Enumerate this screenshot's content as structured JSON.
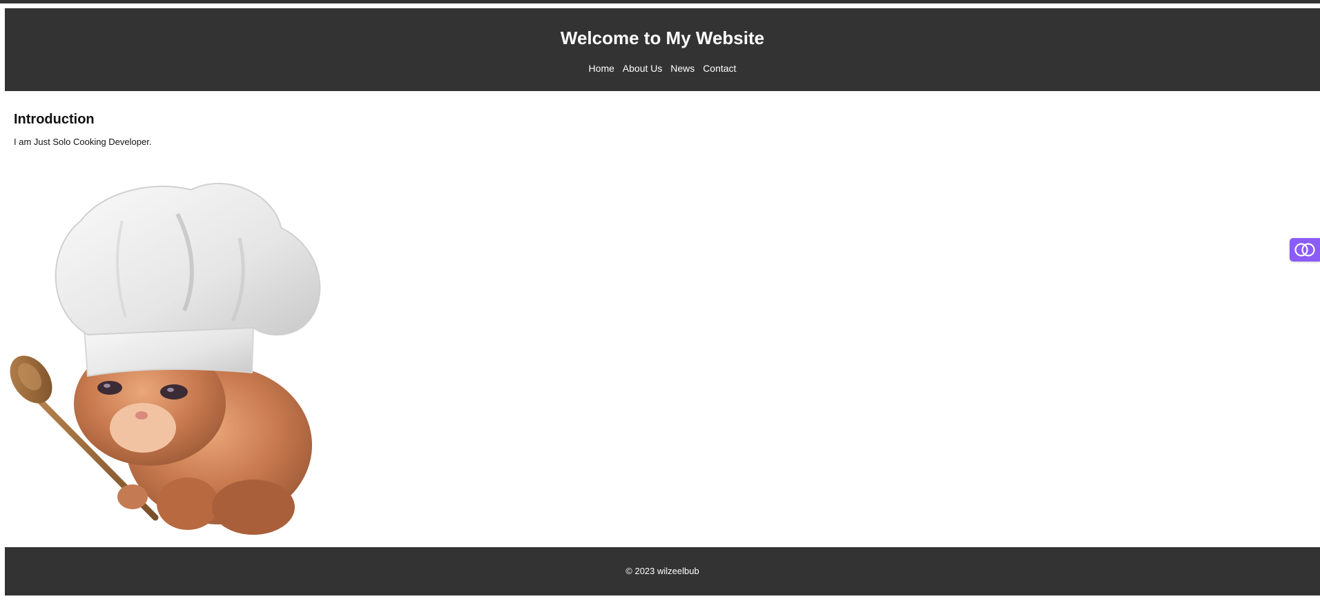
{
  "header": {
    "title": "Welcome to My Website",
    "nav": [
      {
        "label": "Home"
      },
      {
        "label": "About Us"
      },
      {
        "label": "News"
      },
      {
        "label": "Contact"
      }
    ]
  },
  "main": {
    "section_title": "Introduction",
    "intro_text": "I am Just Solo Cooking Developer.",
    "image_icon": "chef-kitten-illustration"
  },
  "footer": {
    "text": "© 2023 wilzeelbub"
  },
  "widget": {
    "icon": "overlapping-circles-icon",
    "color": "#8b5cf6"
  },
  "colors": {
    "header_bg": "#333333",
    "footer_bg": "#333333",
    "text_light": "#ffffff"
  }
}
